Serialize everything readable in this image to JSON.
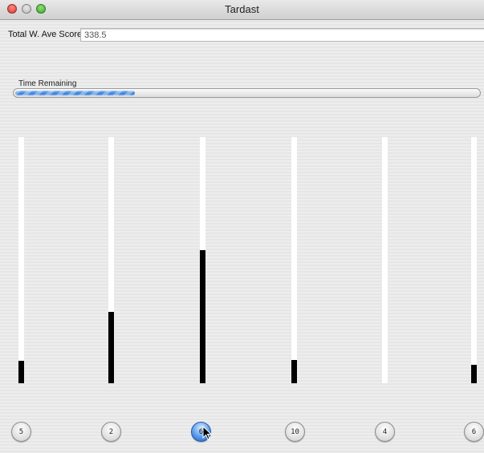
{
  "window": {
    "title": "Tardast"
  },
  "score": {
    "label": "Total W. Ave Score",
    "value": "338.5"
  },
  "progress": {
    "label": "Time Remaining",
    "fraction": 0.26
  },
  "columns": [
    {
      "level": 0.09,
      "button_label": "5",
      "selected": false
    },
    {
      "level": 0.29,
      "button_label": "2",
      "selected": false
    },
    {
      "level": 0.54,
      "button_label": "6",
      "selected": true
    },
    {
      "level": 0.095,
      "button_label": "10",
      "selected": false
    },
    {
      "level": 0.0,
      "button_label": "4",
      "selected": false
    },
    {
      "level": 0.075,
      "button_label": "6",
      "selected": false
    }
  ],
  "colors": {
    "bar": "#000000",
    "track": "#ffffff",
    "progress": "#3a7fd9",
    "selected_button": "#5b9cf0"
  }
}
